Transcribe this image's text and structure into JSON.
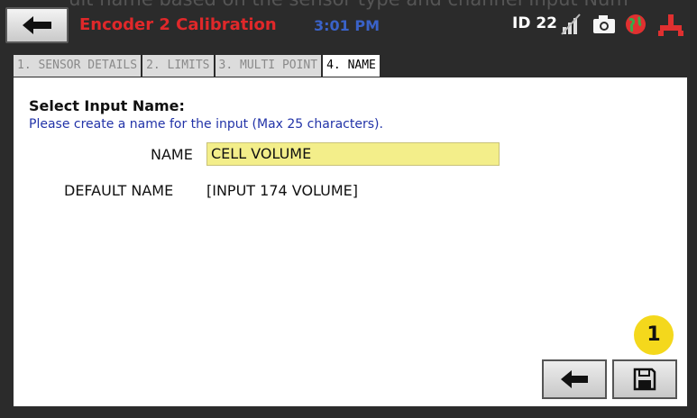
{
  "caption": "ult name based on the sensor type and channel Input Num",
  "header": {
    "back_icon": "arrow-left-icon",
    "title": "Encoder 2 Calibration",
    "time": "3:01 PM",
    "id_label": "ID 22",
    "status_icons": [
      "signal-off-icon",
      "camera-icon",
      "globe-icon",
      "pump-icon"
    ],
    "colors": {
      "title": "#e0282a",
      "time": "#3a62c8",
      "id": "#ffffff"
    }
  },
  "tabs": [
    {
      "label": "1. SENSOR DETAILS",
      "active": false
    },
    {
      "label": "2. LIMITS",
      "active": false
    },
    {
      "label": "3. MULTI POINT",
      "active": false
    },
    {
      "label": "4. NAME",
      "active": true
    }
  ],
  "form": {
    "heading": "Select Input Name:",
    "instructions": "Please create a name for the input (Max 25 characters).",
    "name_label": "NAME",
    "name_value": "CELL VOLUME",
    "default_label": "DEFAULT NAME",
    "default_value": "[INPUT 174 VOLUME]"
  },
  "callout": {
    "number": "1",
    "color": "#f4d81c"
  },
  "footer": {
    "back_icon": "arrow-left-icon",
    "save_icon": "floppy-disk-icon"
  }
}
